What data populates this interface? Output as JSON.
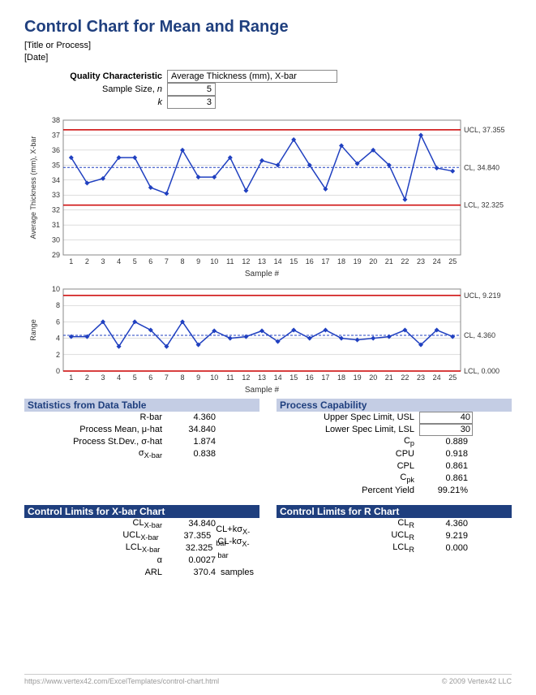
{
  "title": "Control Chart for Mean and Range",
  "meta_title": "[Title or Process]",
  "meta_date": "[Date]",
  "inputs": {
    "qc_label": "Quality Characteristic",
    "qc_value": "Average Thickness (mm), X-bar",
    "n_label_html": "Sample Size, <i>n</i>",
    "n_value": "5",
    "k_label_html": "<i>k</i>",
    "k_value": "3"
  },
  "chart_data": [
    {
      "type": "line",
      "title": "",
      "xlabel": "Sample #",
      "ylabel": "Average Thickness (mm), X-bar",
      "ylim": [
        29,
        38
      ],
      "yticks": [
        29,
        30,
        31,
        32,
        33,
        34,
        35,
        36,
        37,
        38
      ],
      "x": [
        1,
        2,
        3,
        4,
        5,
        6,
        7,
        8,
        9,
        10,
        11,
        12,
        13,
        14,
        15,
        16,
        17,
        18,
        19,
        20,
        21,
        22,
        23,
        24,
        25
      ],
      "values": [
        35.5,
        33.8,
        34.1,
        35.5,
        35.5,
        33.5,
        33.1,
        36.0,
        34.2,
        34.2,
        35.5,
        33.3,
        35.3,
        35.0,
        36.7,
        35.0,
        33.4,
        36.3,
        35.1,
        36.0,
        35.0,
        32.7,
        37.0,
        34.8,
        34.6
      ],
      "ucl": 37.355,
      "cl": 34.84,
      "lcl": 32.325,
      "ucl_label": "UCL, 37.355",
      "cl_label": "CL, 34.840",
      "lcl_label": "LCL, 32.325"
    },
    {
      "type": "line",
      "title": "",
      "xlabel": "Sample #",
      "ylabel": "Range",
      "ylim": [
        0,
        10
      ],
      "yticks": [
        0,
        2,
        4,
        6,
        8,
        10
      ],
      "x": [
        1,
        2,
        3,
        4,
        5,
        6,
        7,
        8,
        9,
        10,
        11,
        12,
        13,
        14,
        15,
        16,
        17,
        18,
        19,
        20,
        21,
        22,
        23,
        24,
        25
      ],
      "values": [
        4.2,
        4.2,
        6.0,
        3.0,
        6.0,
        5.0,
        3.0,
        6.0,
        3.2,
        4.9,
        4.0,
        4.2,
        4.9,
        3.6,
        5.0,
        4.0,
        5.0,
        4.0,
        3.8,
        4.0,
        4.2,
        5.0,
        3.2,
        5.0,
        4.2
      ],
      "ucl": 9.219,
      "cl": 4.36,
      "lcl": 0.0,
      "ucl_label": "UCL, 9.219",
      "cl_label": "CL, 4.360",
      "lcl_label": "LCL, 0.000"
    }
  ],
  "stats_hdr": "Statistics from Data Table",
  "stats": [
    {
      "label": "R-bar",
      "value": "4.360"
    },
    {
      "label": "Process Mean, μ-hat",
      "value": "34.840"
    },
    {
      "label": "Process St.Dev., σ-hat",
      "value": "1.874"
    },
    {
      "label": "σ<sub>X-bar</sub>",
      "value": "0.838"
    }
  ],
  "cap_hdr": "Process Capability",
  "cap": [
    {
      "label": "Upper Spec Limit, USL",
      "value": "40",
      "box": true
    },
    {
      "label": "Lower Spec Limit, LSL",
      "value": "30",
      "box": true
    },
    {
      "label": "C<sub>p</sub>",
      "value": "0.889"
    },
    {
      "label": "CPU",
      "value": "0.918"
    },
    {
      "label": "CPL",
      "value": "0.861"
    },
    {
      "label": "C<sub>pk</sub>",
      "value": "0.861"
    },
    {
      "label": "Percent Yield",
      "value": "99.21%"
    }
  ],
  "xbar_hdr": "Control Limits for X-bar Chart",
  "xbar_limits": [
    {
      "label": "CL<sub>X-bar</sub>",
      "value": "34.840",
      "extra": ""
    },
    {
      "label": "UCL<sub>X-bar</sub>",
      "value": "37.355",
      "extra": "CL+kσ<sub>X-bar</sub>"
    },
    {
      "label": "LCL<sub>X-bar</sub>",
      "value": "32.325",
      "extra": "CL-kσ<sub>X-bar</sub>"
    },
    {
      "label": "α",
      "value": "0.0027",
      "extra": ""
    },
    {
      "label": "ARL",
      "value": "370.4",
      "extra": "samples"
    }
  ],
  "r_hdr": "Control Limits for R Chart",
  "r_limits": [
    {
      "label": "CL<sub>R</sub>",
      "value": "4.360"
    },
    {
      "label": "UCL<sub>R</sub>",
      "value": "9.219"
    },
    {
      "label": "LCL<sub>R</sub>",
      "value": "0.000"
    }
  ],
  "footer_left": "https://www.vertex42.com/ExcelTemplates/control-chart.html",
  "footer_right": "© 2009 Vertex42 LLC"
}
